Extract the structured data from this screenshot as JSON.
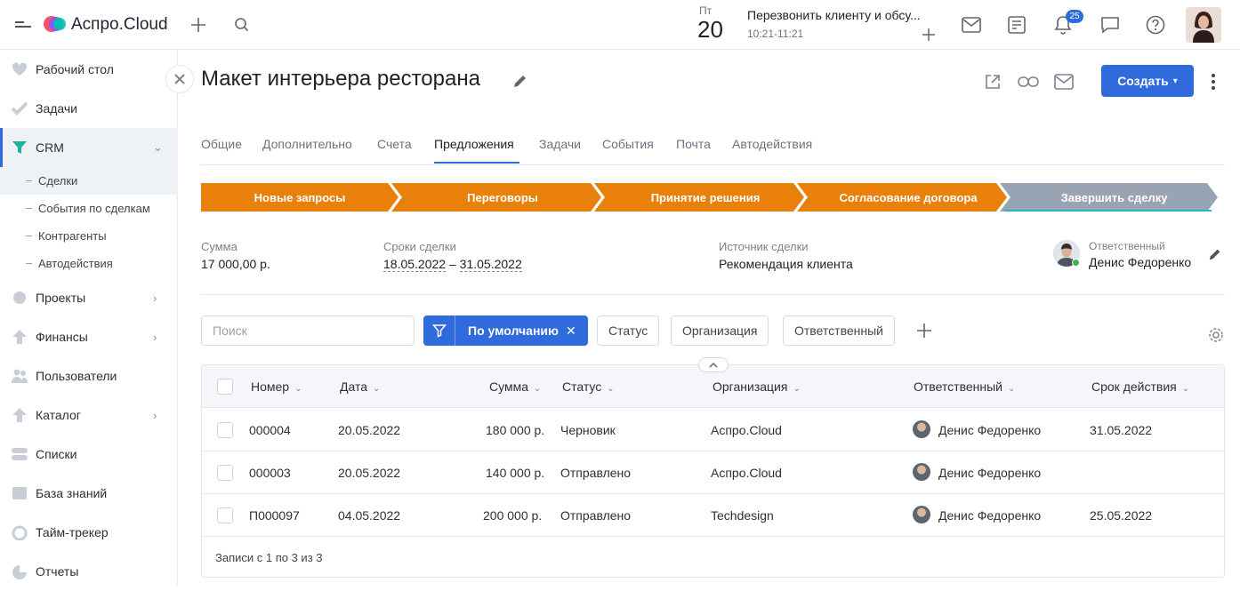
{
  "app": {
    "brand": "Аспро.Cloud"
  },
  "header": {
    "day_label": "Пт",
    "day_number": "20",
    "reminder_title": "Перезвонить клиенту и обсу...",
    "reminder_time": "10:21-11:21",
    "notifications_count": "25"
  },
  "sidebar": {
    "items": [
      {
        "label": "Рабочий стол"
      },
      {
        "label": "Задачи"
      },
      {
        "label": "CRM"
      },
      {
        "label": "Проекты"
      },
      {
        "label": "Финансы"
      },
      {
        "label": "Пользователи"
      },
      {
        "label": "Каталог"
      },
      {
        "label": "Списки"
      },
      {
        "label": "База знаний"
      },
      {
        "label": "Тайм-трекер"
      },
      {
        "label": "Отчеты"
      }
    ],
    "crm_sub": [
      {
        "label": "Сделки"
      },
      {
        "label": "События по сделкам"
      },
      {
        "label": "Контрагенты"
      },
      {
        "label": "Автодействия"
      }
    ]
  },
  "page": {
    "title": "Макет интерьера ресторана",
    "create_label": "Создать"
  },
  "tabs": [
    {
      "label": "Общие"
    },
    {
      "label": "Дополнительно"
    },
    {
      "label": "Счета"
    },
    {
      "label": "Предложения"
    },
    {
      "label": "Задачи"
    },
    {
      "label": "События"
    },
    {
      "label": "Почта"
    },
    {
      "label": "Автодействия"
    }
  ],
  "stages": [
    {
      "label": "Новые запросы",
      "color": "#e8800a"
    },
    {
      "label": "Переговоры",
      "color": "#e8800a"
    },
    {
      "label": "Принятие решения",
      "color": "#e8800a"
    },
    {
      "label": "Согласование договора",
      "color": "#e8800a"
    },
    {
      "label": "Завершить сделку",
      "color": "#98a3b3"
    }
  ],
  "deal": {
    "sum_label": "Сумма",
    "sum_value": "17 000,00 р.",
    "dates_label": "Сроки сделки",
    "date_from": "18.05.2022",
    "date_sep": "–",
    "date_to": "31.05.2022",
    "source_label": "Источник сделки",
    "source_value": "Рекомендация клиента",
    "owner_label": "Ответственный",
    "owner_value": "Денис Федоренко"
  },
  "filters": {
    "search_placeholder": "Поиск",
    "active_filter": "По умолчанию",
    "chips": [
      "Статус",
      "Организация",
      "Ответственный"
    ]
  },
  "table": {
    "columns": [
      "Номер",
      "Дата",
      "Сумма",
      "Статус",
      "Организация",
      "Ответственный",
      "Срок действия"
    ],
    "rows": [
      {
        "number": "000004",
        "date": "20.05.2022",
        "sum": "180 000 р.",
        "status": "Черновик",
        "org": "Аспро.Cloud",
        "owner": "Денис Федоренко",
        "valid": "31.05.2022"
      },
      {
        "number": "000003",
        "date": "20.05.2022",
        "sum": "140 000 р.",
        "status": "Отправлено",
        "org": "Аспро.Cloud",
        "owner": "Денис Федоренко",
        "valid": ""
      },
      {
        "number": "П000097",
        "date": "04.05.2022",
        "sum": "200 000 р.",
        "status": "Отправлено",
        "org": "Techdesign",
        "owner": "Денис Федоренко",
        "valid": "25.05.2022"
      }
    ],
    "footer": "Записи с 1 по 3 из 3"
  },
  "colors": {
    "accent": "#2f6bdd",
    "stage_active": "#e8800a",
    "stage_final": "#98a3b3"
  }
}
